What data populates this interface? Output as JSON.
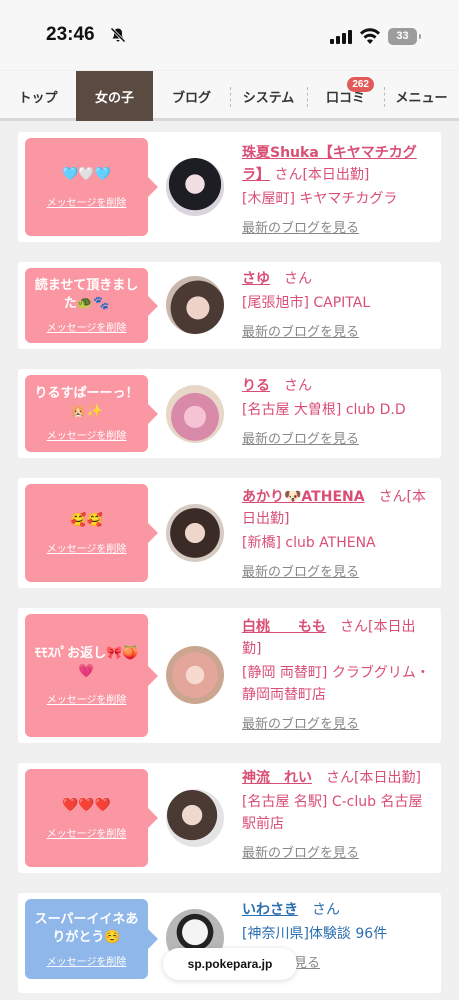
{
  "status": {
    "time": "23:46",
    "battery": "33"
  },
  "tabs": [
    {
      "label": "トップ"
    },
    {
      "label": "女の子"
    },
    {
      "label": "ブログ"
    },
    {
      "label": "システム"
    },
    {
      "label": "口コミ",
      "badge": "262"
    },
    {
      "label": "メニュー"
    }
  ],
  "delete_label": "メッセージを削除",
  "blog_label": "最新のブログを見る",
  "cards": [
    {
      "message": "🩵🤍🩵",
      "name": "珠夏Shuka【キヤマチカグラ】",
      "san": "さん[本日出勤]",
      "place": "[木屋町] キヤマチカグラ",
      "blog": "最新のブログを見る"
    },
    {
      "message": "読ませて頂きました🐢🐾",
      "name": "さゆ",
      "san": "さん",
      "place": "[尾張旭市] CAPITAL",
      "blog": "最新のブログを見る"
    },
    {
      "message": "りるすぱーーっ！🐹✨",
      "name": "りる",
      "san": "さん",
      "place": "[名古屋 大曽根] club D.D",
      "blog": "最新のブログを見る"
    },
    {
      "message": "🥰🥰",
      "name": "あかり🐶ATHENA",
      "san": "さん[本日出勤]",
      "place": "[新橋] club ATHENA",
      "blog": "最新のブログを見る"
    },
    {
      "message": "ﾓﾓｽﾊﾟお返し🎀🍑💗",
      "name": "白桃　　もも",
      "san": "さん[本日出勤]",
      "place": "[静岡 両替町] クラブグリム・静岡両替町店",
      "blog": "最新のブログを見る"
    },
    {
      "message": "❤️❤️❤️",
      "name": "神流　れい",
      "san": "さん[本日出勤]",
      "place": "[名古屋 名駅] C-club 名古屋駅前店",
      "blog": "最新のブログを見る"
    },
    {
      "message": "スーパーイイネありがとう☺️",
      "name": "いわさき",
      "san": "さん",
      "place": "[神奈川県]体験談 96件",
      "blog": "体験談を見る"
    }
  ],
  "url": "sp.pokepara.jp",
  "colors": {
    "accent": "#d94f74",
    "bubble_pink": "#fa97a3",
    "bubble_blue": "#8fb7ea",
    "tab_active": "#5a4a40"
  }
}
